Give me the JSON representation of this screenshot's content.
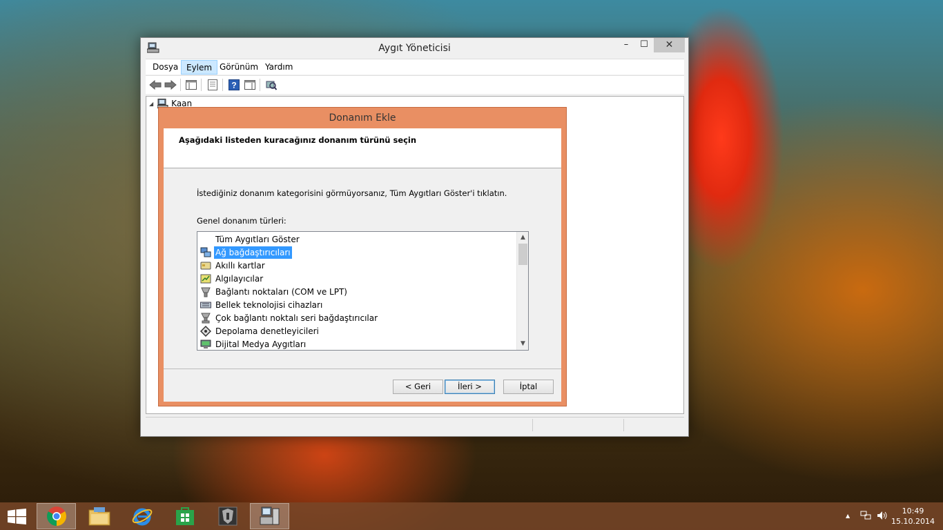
{
  "window": {
    "title": "Aygıt Yöneticisi",
    "controls": {
      "minimize": "–",
      "maximize": "☐",
      "close": "✕"
    }
  },
  "menu": {
    "items": [
      {
        "label": "Dosya"
      },
      {
        "label": "Eylem",
        "active": true
      },
      {
        "label": "Görünüm"
      },
      {
        "label": "Yardım"
      }
    ]
  },
  "toolbar": {
    "buttons": [
      "back-arrow-icon",
      "forward-arrow-icon",
      "show-hide-console-tree-icon",
      "properties-icon",
      "help-icon",
      "action-pane-icon",
      "scan-hardware-icon"
    ]
  },
  "tree": {
    "root_label": "Kaan",
    "expander": "◢"
  },
  "dialog": {
    "title": "Donanım Ekle",
    "heading": "Aşağıdaki listeden kuracağınız donanım türünü seçin",
    "description": "İstediğiniz donanım kategorisini görmüyorsanız, Tüm Aygıtları Göster'i tıklatın.",
    "list_label": "Genel donanım türleri:",
    "list_items": [
      {
        "label": "Tüm Aygıtları Göster",
        "icon": "none"
      },
      {
        "label": "Ağ bağdaştırıcıları",
        "icon": "network-adapter-icon",
        "selected": true
      },
      {
        "label": "Akıllı kartlar",
        "icon": "smart-card-icon"
      },
      {
        "label": "Algılayıcılar",
        "icon": "sensor-icon"
      },
      {
        "label": "Bağlantı noktaları (COM ve LPT)",
        "icon": "port-icon"
      },
      {
        "label": "Bellek teknolojisi cihazları",
        "icon": "memory-device-icon"
      },
      {
        "label": "Çok bağlantı noktalı seri bağdaştırıcılar",
        "icon": "multiport-serial-icon"
      },
      {
        "label": "Depolama denetleyicileri",
        "icon": "storage-controller-icon"
      },
      {
        "label": "Dijital Medya Aygıtları",
        "icon": "digital-media-icon"
      }
    ],
    "buttons": {
      "back": "< Geri",
      "next": "İleri >",
      "cancel": "İptal"
    }
  },
  "taskbar": {
    "apps": [
      "chrome-icon",
      "file-explorer-icon",
      "internet-explorer-icon",
      "store-icon",
      "app-icon",
      "device-manager-icon"
    ],
    "tray": {
      "up_arrow": "▲",
      "time": "10:49",
      "date": "15.10.2014"
    }
  },
  "colors": {
    "dialog_frame": "#e98f63",
    "selection": "#3399ff",
    "menu_active": "#cce8ff"
  }
}
